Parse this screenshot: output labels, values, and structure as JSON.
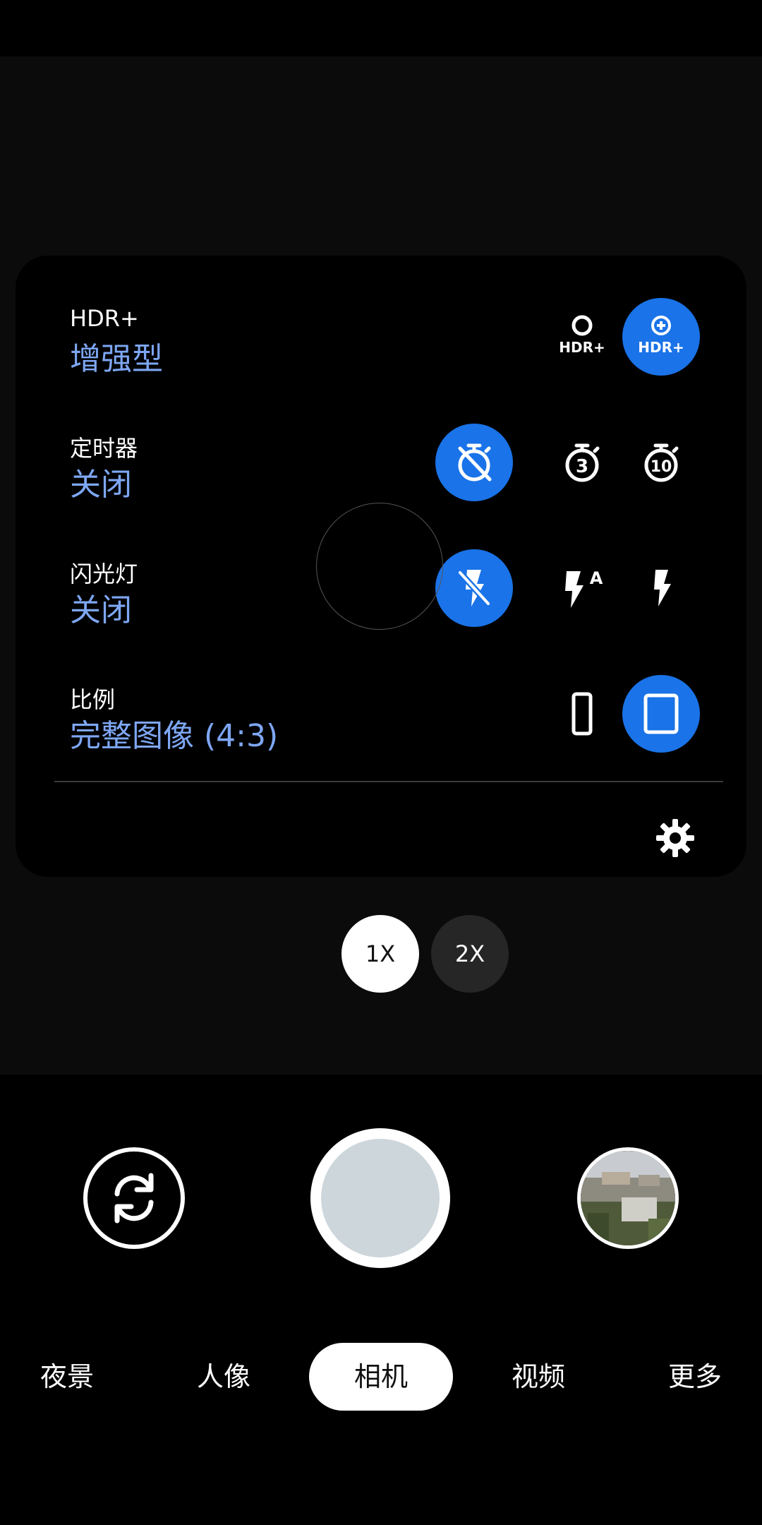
{
  "settings": {
    "hdr": {
      "title": "HDR+",
      "value": "增强型",
      "options": [
        {
          "icon": "hdr-plus-off-icon",
          "label": "HDR+",
          "selected": false
        },
        {
          "icon": "hdr-plus-enhanced-icon",
          "label": "HDR+",
          "selected": true
        }
      ]
    },
    "timer": {
      "title": "定时器",
      "value": "关闭",
      "options": [
        {
          "icon": "timer-off-icon",
          "selected": true
        },
        {
          "icon": "timer-3-icon",
          "label": "3",
          "selected": false
        },
        {
          "icon": "timer-10-icon",
          "label": "10",
          "selected": false
        }
      ]
    },
    "flash": {
      "title": "闪光灯",
      "value": "关闭",
      "options": [
        {
          "icon": "flash-off-icon",
          "selected": true
        },
        {
          "icon": "flash-auto-icon",
          "label": "A",
          "selected": false
        },
        {
          "icon": "flash-on-icon",
          "selected": false
        }
      ]
    },
    "ratio": {
      "title": "比例",
      "value": "完整图像 (4:3)",
      "options": [
        {
          "icon": "ratio-tall-icon",
          "selected": false
        },
        {
          "icon": "ratio-4-3-icon",
          "selected": true
        }
      ]
    }
  },
  "zoom": {
    "options": [
      "1X",
      "2X"
    ],
    "selected": "1X"
  },
  "modes": {
    "items": [
      "夜景",
      "人像",
      "相机",
      "视频",
      "更多"
    ],
    "selected": "相机"
  },
  "colors": {
    "accent": "#1a73e8",
    "accent_text": "#7ea7f4",
    "shutter_inner": "#ccd6db"
  }
}
